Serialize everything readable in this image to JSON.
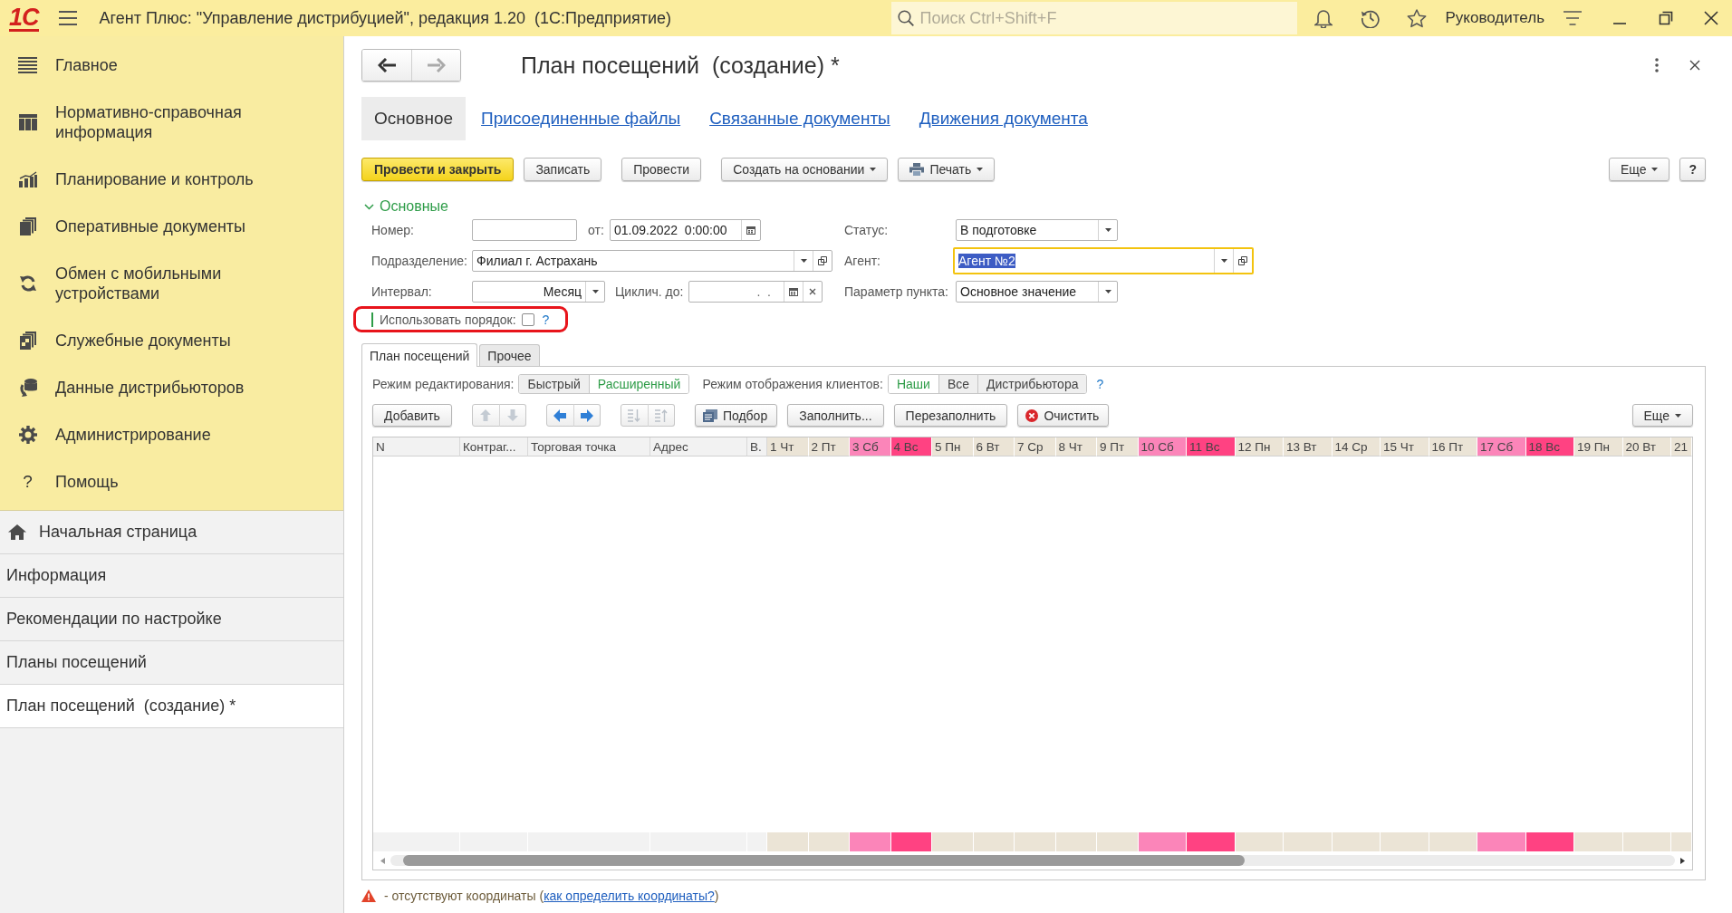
{
  "app_bar": {
    "logo": "1С",
    "title": "Агент Плюс: \"Управление дистрибуцией\", редакция 1.20  (1С:Предприятие)",
    "search": {
      "placeholder": "Поиск Ctrl+Shift+F"
    },
    "user": "Руководитель"
  },
  "sidebar": {
    "sections": [
      {
        "label": "Главное"
      },
      {
        "label": "Нормативно-справочная информация"
      },
      {
        "label": "Планирование и контроль"
      },
      {
        "label": "Оперативные документы"
      },
      {
        "label": "Обмен с мобильными устройствами"
      },
      {
        "label": "Служебные документы"
      },
      {
        "label": "Данные дистрибьюторов"
      },
      {
        "label": "Администрирование"
      },
      {
        "label": "Помощь",
        "glyph": "?"
      }
    ],
    "open_windows": [
      {
        "kind": "home",
        "label": "Начальная страница",
        "selected": false
      },
      {
        "kind": "window",
        "label": "Информация",
        "selected": false
      },
      {
        "kind": "window",
        "label": "Рекомендации по настройке",
        "selected": false
      },
      {
        "kind": "window",
        "label": "Планы посещений",
        "selected": false
      },
      {
        "kind": "window",
        "label": "План посещений  (создание) *",
        "selected": true
      }
    ]
  },
  "form": {
    "history_nav": [
      {
        "kind": "back",
        "disabled": false
      },
      {
        "kind": "forward",
        "disabled": true
      }
    ],
    "title": "План посещений  (создание) *",
    "tabs": [
      {
        "label": "Основное",
        "selected": true
      },
      {
        "label": "Присоединенные файлы",
        "selected": false
      },
      {
        "label": "Связанные документы",
        "selected": false
      },
      {
        "label": "Движения документа",
        "selected": false
      }
    ],
    "toolbar": [
      {
        "kind": "primary",
        "label": "Провести и закрыть"
      },
      {
        "kind": "plain",
        "label": "Записать"
      },
      {
        "kind": "plain",
        "label": "Провести"
      },
      {
        "kind": "menu",
        "label": "Создать на основании"
      },
      {
        "kind": "print_menu",
        "label": "Печать"
      }
    ],
    "toolbar_right": [
      {
        "kind": "menu",
        "label": "Еще"
      },
      {
        "kind": "plain",
        "label": "?"
      }
    ],
    "group": {
      "title": "Основные",
      "expanded": true
    },
    "fields": {
      "number": {
        "label": "Номер:"
      },
      "date": {
        "label": "от:",
        "value": "01.09.2022  0:00:00"
      },
      "status": {
        "label": "Статус:",
        "value": "В подготовке"
      },
      "department": {
        "label": "Подразделение:",
        "value": "Филиал г. Астрахань"
      },
      "agent": {
        "label": "Агент:",
        "value": "Агент №2",
        "focused": true,
        "text_selected": true
      },
      "interval": {
        "label": "Интервал:",
        "value": "Месяц"
      },
      "cyclic_until": {
        "label": "Циклич. до:",
        "value": ".  ."
      },
      "point_parameter": {
        "label": "Параметр пункта:",
        "value": "Основное значение"
      },
      "use_order": {
        "label": "Использовать порядок:",
        "checked": false,
        "highlighted": true,
        "help": "?"
      }
    },
    "sub_tabs": [
      {
        "label": "План посещений",
        "selected": true
      },
      {
        "label": "Прочее",
        "selected": false
      }
    ],
    "edit_mode": {
      "label": "Режим редактирования:",
      "options": [
        {
          "label": "Быстрый",
          "selected": false
        },
        {
          "label": "Расширенный",
          "selected": true
        }
      ]
    },
    "client_mode": {
      "label": "Режим отображения клиентов:",
      "options": [
        {
          "label": "Наши",
          "selected": true
        },
        {
          "label": "Все",
          "selected": false
        },
        {
          "label": "Дистрибьютора",
          "selected": false
        }
      ],
      "help": "?"
    },
    "row_toolbar": [
      {
        "kind": "plain",
        "label": "Добавить",
        "disabled": false
      },
      {
        "kind": "up_down",
        "disabled": true
      },
      {
        "kind": "left_right",
        "disabled": false
      },
      {
        "kind": "sort",
        "disabled": true
      },
      {
        "kind": "pick",
        "label": "Подбор",
        "disabled": false
      },
      {
        "kind": "plain",
        "label": "Заполнить...",
        "disabled": false
      },
      {
        "kind": "plain",
        "label": "Перезаполнить",
        "disabled": false
      },
      {
        "kind": "clear",
        "label": "Очистить",
        "disabled": false
      }
    ],
    "row_toolbar_right": {
      "label": "Еще"
    },
    "table": {
      "columns": [
        {
          "label": "N"
        },
        {
          "label": "Контраг..."
        },
        {
          "label": "Торговая точка"
        },
        {
          "label": "Адрес"
        },
        {
          "label": "В."
        }
      ],
      "day_columns": [
        {
          "label": "1 Чт",
          "color": "#ebe4d6"
        },
        {
          "label": "2 Пт",
          "color": "#ebe4d6"
        },
        {
          "label": "3 Сб",
          "color": "#fb85b9"
        },
        {
          "label": "4 Вс",
          "color": "#ff4282"
        },
        {
          "label": "5 Пн",
          "color": "#ebe4d6"
        },
        {
          "label": "6 Вт",
          "color": "#ebe4d6"
        },
        {
          "label": "7 Ср",
          "color": "#ebe4d6"
        },
        {
          "label": "8 Чт",
          "color": "#ebe4d6"
        },
        {
          "label": "9 Пт",
          "color": "#ebe4d6"
        },
        {
          "label": "10 Сб",
          "color": "#fb85b9"
        },
        {
          "label": "11 Вс",
          "color": "#ff4282"
        },
        {
          "label": "12 Пн",
          "color": "#ebe4d6"
        },
        {
          "label": "13 Вт",
          "color": "#ebe4d6"
        },
        {
          "label": "14 Ср",
          "color": "#ebe4d6"
        },
        {
          "label": "15 Чт",
          "color": "#ebe4d6"
        },
        {
          "label": "16 Пт",
          "color": "#ebe4d6"
        },
        {
          "label": "17 Сб",
          "color": "#fb85b9"
        },
        {
          "label": "18 Вс",
          "color": "#ff4282"
        },
        {
          "label": "19 Пн",
          "color": "#ebe4d6"
        },
        {
          "label": "20 Вт",
          "color": "#ebe4d6"
        },
        {
          "label": "21",
          "color": "#ebe4d6"
        }
      ]
    },
    "note": {
      "before": "- отсутствуют координаты (",
      "link": "как определить координаты?",
      "after": ")"
    }
  }
}
